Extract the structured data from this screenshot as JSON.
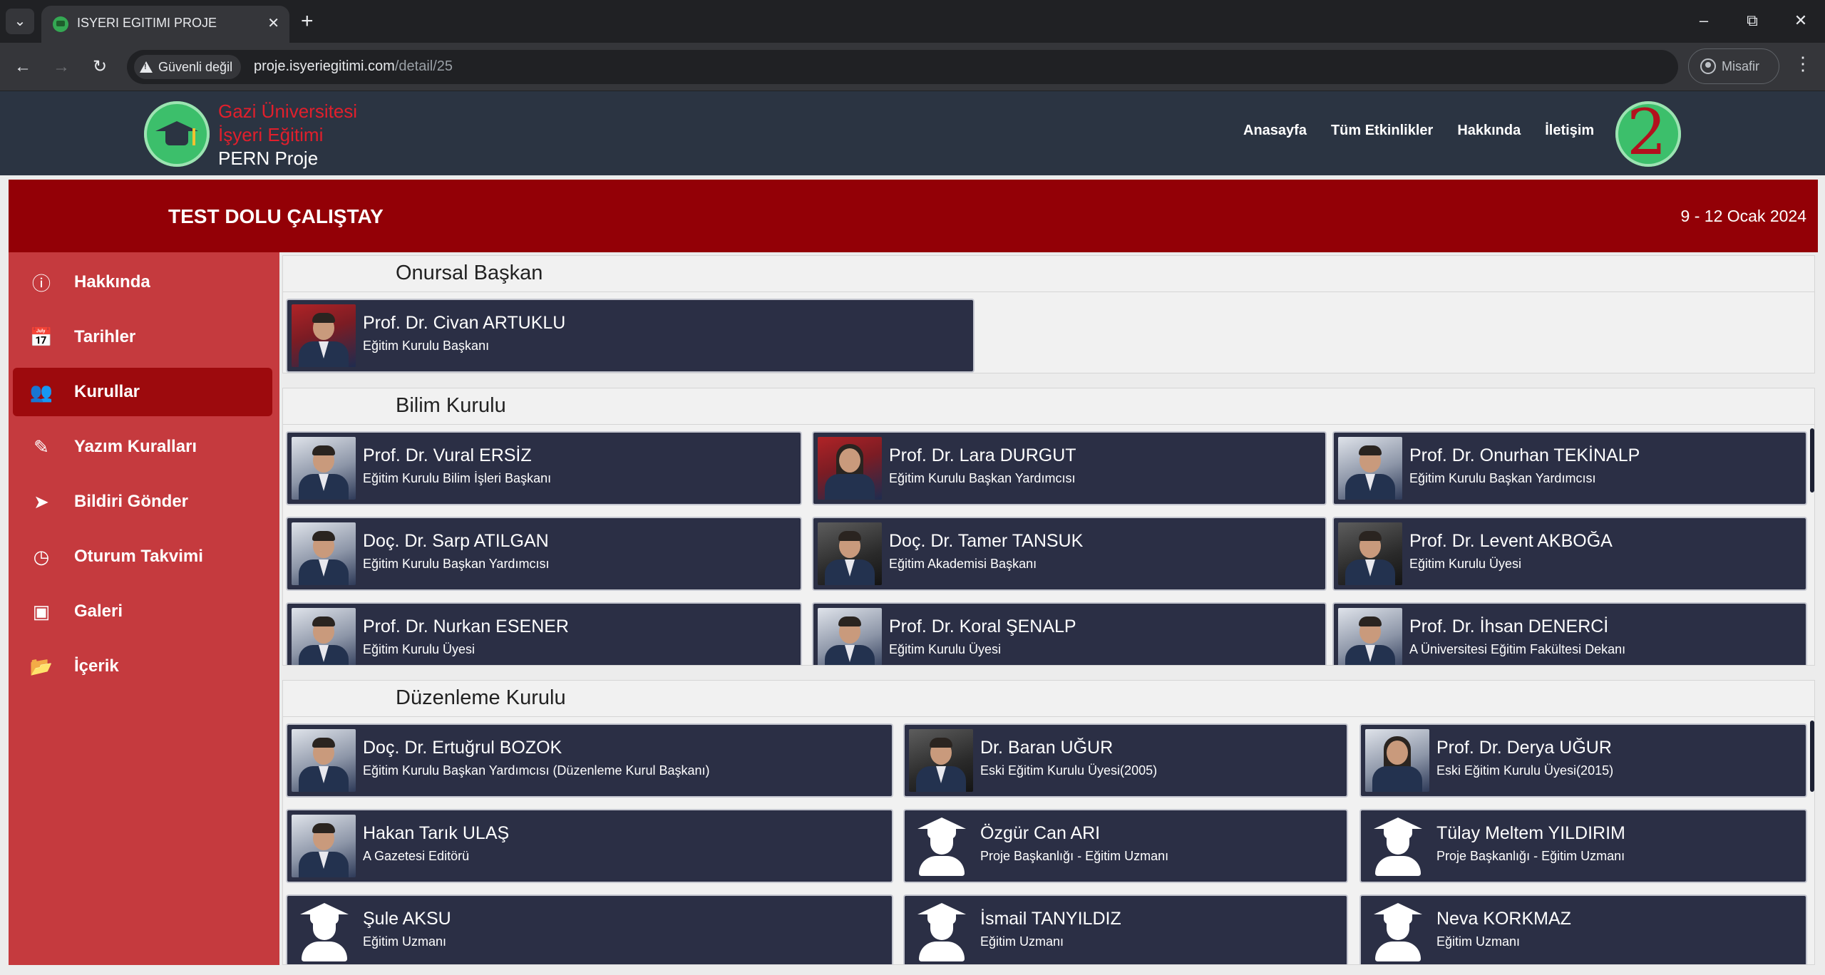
{
  "browser": {
    "tab_title": "ISYERI EGITIMI PROJE",
    "new_tab": "+",
    "security_label": "Güvenli değil",
    "url_host": "proje.isyeriegitimi.com",
    "url_path": "/detail/25",
    "profile_label": "Misafir"
  },
  "header": {
    "brand_line1": "Gazi Üniversitesi",
    "brand_line2": "İşyeri Eğitimi",
    "brand_line3": "PERN Proje",
    "nav": [
      "Anasayfa",
      "Tüm Etkinlikler",
      "Hakkında",
      "İletişim"
    ],
    "right_logo_text": "2"
  },
  "event": {
    "title": "TEST DOLU ÇALIŞTAY",
    "date": "9 - 12 Ocak 2024"
  },
  "sidebar": {
    "items": [
      {
        "label": "Hakkında",
        "icon": "info-circle-icon",
        "active": false
      },
      {
        "label": "Tarihler",
        "icon": "calendar-icon",
        "active": false
      },
      {
        "label": "Kurullar",
        "icon": "users-icon",
        "active": true
      },
      {
        "label": "Yazım Kuralları",
        "icon": "pen-icon",
        "active": false
      },
      {
        "label": "Bildiri Gönder",
        "icon": "paper-plane-icon",
        "active": false
      },
      {
        "label": "Oturum Takvimi",
        "icon": "clock-icon",
        "active": false
      },
      {
        "label": "Galeri",
        "icon": "images-icon",
        "active": false
      },
      {
        "label": "İçerik",
        "icon": "folder-open-icon",
        "active": false
      }
    ]
  },
  "sections": {
    "honorary": {
      "title": "Onursal Başkan",
      "members": [
        {
          "name": "Prof. Dr. Civan ARTUKLU",
          "role": "Eğitim Kurulu Başkanı"
        }
      ]
    },
    "science": {
      "title": "Bilim Kurulu",
      "members": [
        {
          "name": "Prof. Dr. Vural ERSİZ",
          "role": "Eğitim Kurulu Bilim İşleri Başkanı"
        },
        {
          "name": "Prof. Dr. Lara DURGUT",
          "role": "Eğitim Kurulu Başkan Yardımcısı"
        },
        {
          "name": "Prof. Dr. Onurhan TEKİNALP",
          "role": "Eğitim Kurulu Başkan Yardımcısı"
        },
        {
          "name": "Doç. Dr. Sarp ATILGAN",
          "role": "Eğitim Kurulu Başkan Yardımcısı"
        },
        {
          "name": "Doç. Dr. Tamer TANSUK",
          "role": "Eğitim Akademisi Başkanı"
        },
        {
          "name": "Prof. Dr. Levent AKBOĞA",
          "role": "Eğitim Kurulu Üyesi"
        },
        {
          "name": "Prof. Dr. Nurkan ESENER",
          "role": "Eğitim Kurulu Üyesi"
        },
        {
          "name": "Prof. Dr. Koral ŞENALP",
          "role": "Eğitim Kurulu Üyesi"
        },
        {
          "name": "Prof. Dr. İhsan DENERCİ",
          "role": "A Üniversitesi Eğitim Fakültesi Dekanı"
        }
      ]
    },
    "organizing": {
      "title": "Düzenleme Kurulu",
      "members": [
        {
          "name": "Doç. Dr. Ertuğrul BOZOK",
          "role": "Eğitim Kurulu Başkan Yardımcısı (Düzenleme Kurul Başkanı)"
        },
        {
          "name": "Dr. Baran UĞUR",
          "role": "Eski Eğitim Kurulu Üyesi(2005)"
        },
        {
          "name": "Prof. Dr. Derya UĞUR",
          "role": "Eski Eğitim Kurulu Üyesi(2015)"
        },
        {
          "name": "Hakan Tarık ULAŞ",
          "role": "A Gazetesi Editörü"
        },
        {
          "name": "Özgür Can ARI",
          "role": "Proje Başkanlığı - Eğitim Uzmanı"
        },
        {
          "name": "Tülay Meltem YILDIRIM",
          "role": "Proje Başkanlığı - Eğitim Uzmanı"
        },
        {
          "name": "Şule AKSU",
          "role": "Eğitim Uzmanı"
        },
        {
          "name": "İsmail TANYILDIZ",
          "role": "Eğitim Uzmanı"
        },
        {
          "name": "Neva KORKMAZ",
          "role": "Eğitim Uzmanı"
        }
      ]
    }
  }
}
